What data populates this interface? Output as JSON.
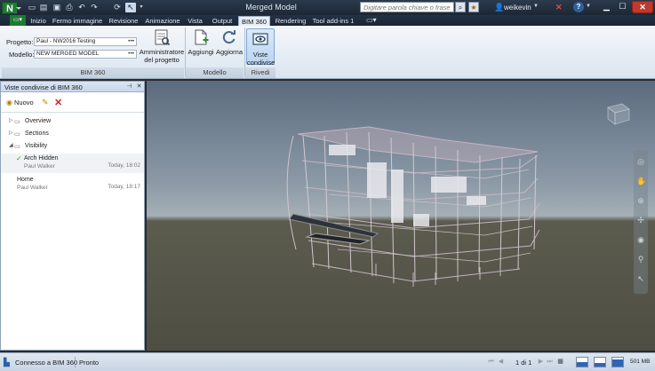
{
  "titlebar": {
    "app_logo": "N",
    "window_title": "Merged Model",
    "search_placeholder": "Digitare parola chiave o frase",
    "user_name": "weikevin",
    "help_label": "?",
    "icons": [
      "open-icon",
      "new-icon",
      "save-icon",
      "print-icon",
      "undo-icon",
      "redo-icon",
      "refresh-icon",
      "select-icon",
      "search-icon",
      "star-icon",
      "user-icon",
      "exchange-icon",
      "help-icon",
      "minimize-icon",
      "maximize-icon",
      "close-icon"
    ]
  },
  "tabs": [
    {
      "label": "Inizio",
      "active": false
    },
    {
      "label": "Fermo immagine",
      "active": false
    },
    {
      "label": "Revisione",
      "active": false
    },
    {
      "label": "Animazione",
      "active": false
    },
    {
      "label": "Vista",
      "active": false
    },
    {
      "label": "Output",
      "active": false
    },
    {
      "label": "BIM 360",
      "active": true
    },
    {
      "label": "Rendering",
      "active": false
    },
    {
      "label": "Tool add-ins 1",
      "active": false
    }
  ],
  "ribbon": {
    "progetto_label": "Progetto:",
    "progetto_value": "Paul - NW2016 Testing",
    "modello_label": "Modello:",
    "modello_value": "NEW MERGED MODEL",
    "dots": "•••",
    "amministratore_line1": "Amministratore",
    "amministratore_line2": "del progetto",
    "aggiungi_label": "Aggiungi",
    "aggiorna_label": "Aggiorna",
    "viste_line1": "Viste",
    "viste_line2": "condivise",
    "group_bim360": "BIM 360",
    "group_modello": "Modello",
    "group_rivedi": "Rivedi"
  },
  "panel": {
    "title": "Viste condivise di BIM 360",
    "new_label": "Nuovo",
    "tree": [
      {
        "label": "Overview",
        "expanded": false
      },
      {
        "label": "Sections",
        "expanded": false
      },
      {
        "label": "Visibility",
        "expanded": true
      }
    ],
    "views": [
      {
        "name": "Arch Hidden",
        "author": "Paul Walker",
        "date": "Today, 18:02",
        "selected": true
      },
      {
        "name": "Home",
        "author": "Paul Walker",
        "date": "Today, 18:17",
        "selected": false
      }
    ]
  },
  "status": {
    "connection": "Connesso a BIM 360",
    "state": "Pronto",
    "page": "1 di 1",
    "memory": "501 MB",
    "perf_fill": [
      0.55,
      0.4,
      0.85
    ]
  },
  "colors": {
    "accent": "#1e7a34",
    "titlebar": "#2c3a4d",
    "ribbon": "#e7edf5",
    "selection": "#b9d4f1"
  }
}
